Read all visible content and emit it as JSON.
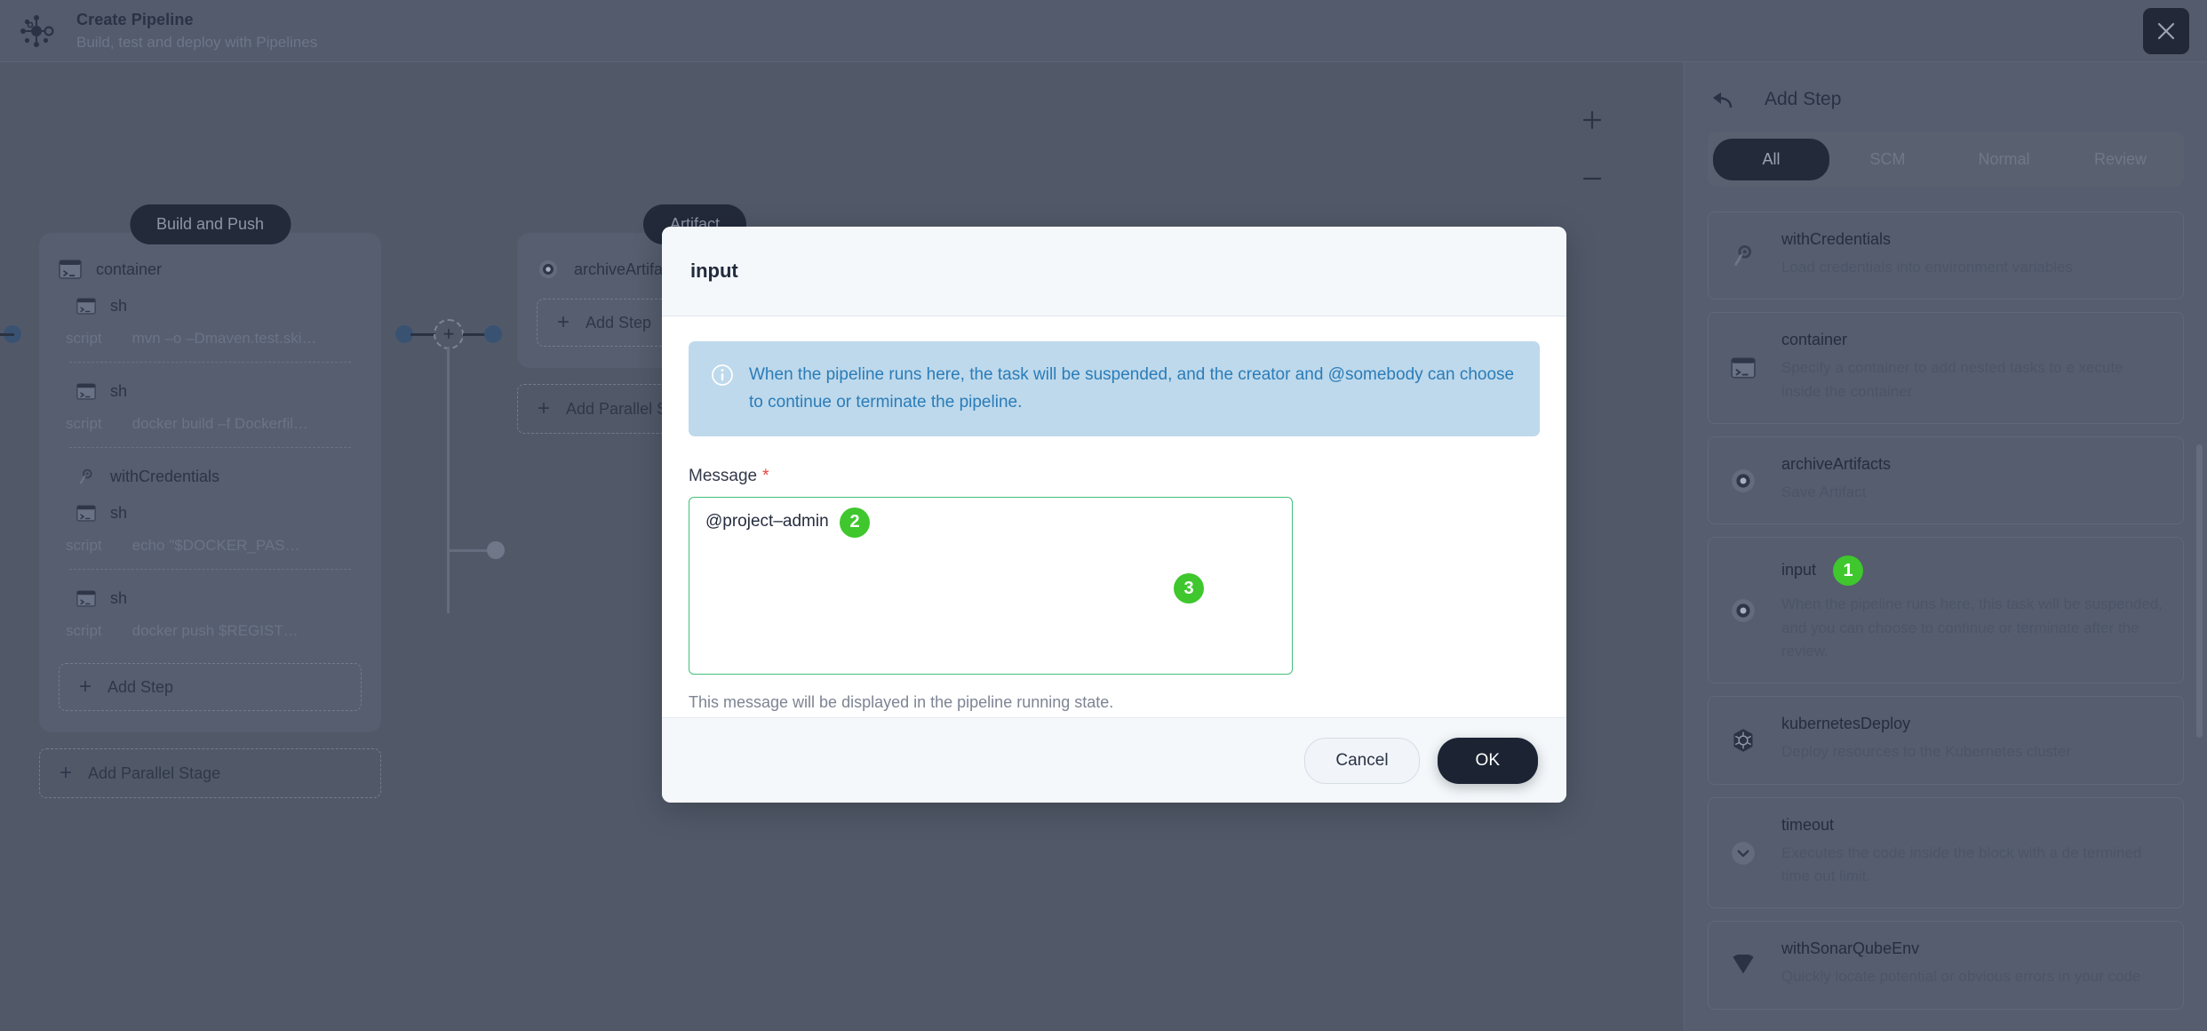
{
  "header": {
    "title": "Create Pipeline",
    "subtitle": "Build, test and deploy with Pipelines",
    "brand_icon": "pipeline-node-icon",
    "close_icon": "close-icon"
  },
  "canvas": {
    "zoom_in_label": "+",
    "zoom_out_label": "−",
    "stages": [
      {
        "label": "Build and Push",
        "steps": [
          {
            "icon": "terminal-icon",
            "name": "container",
            "indent": false
          },
          {
            "icon": "terminal-icon",
            "name": "sh",
            "indent": true,
            "script_key": "script",
            "script_value": "mvn –o –Dmaven.test.ski…"
          },
          {
            "icon": "terminal-icon",
            "name": "sh",
            "indent": true,
            "script_key": "script",
            "script_value": "docker build –f Dockerfil…"
          },
          {
            "icon": "key-icon",
            "name": "withCredentials",
            "indent": true
          },
          {
            "icon": "terminal-icon",
            "name": "sh",
            "indent": true,
            "script_key": "script",
            "script_value": "echo \"$DOCKER_PAS…"
          },
          {
            "icon": "terminal-icon",
            "name": "sh",
            "indent": true,
            "script_key": "script",
            "script_value": "docker push $REGIST…"
          }
        ],
        "add_step_label": "Add Step",
        "add_parallel_label": "Add Parallel Stage"
      },
      {
        "label": "Artifact",
        "steps": [
          {
            "icon": "record-icon",
            "name": "archiveArtifa",
            "indent": false
          }
        ],
        "add_step_label": "Add Step",
        "add_parallel_label": "Add Parallel S"
      }
    ],
    "plus_node_label": "+"
  },
  "right_panel": {
    "back_icon": "back-arrow-icon",
    "title": "Add Step",
    "tabs": [
      {
        "label": "All",
        "active": true
      },
      {
        "label": "SCM",
        "active": false
      },
      {
        "label": "Normal",
        "active": false
      },
      {
        "label": "Review",
        "active": false
      }
    ],
    "items": [
      {
        "icon": "key-icon",
        "name": "withCredentials",
        "desc": "Load credentials into environment variables",
        "badge": null
      },
      {
        "icon": "terminal-icon",
        "name": "container",
        "desc": "Specify a container to add nested tasks to e xecute inside the container",
        "badge": null
      },
      {
        "icon": "record-icon",
        "name": "archiveArtifacts",
        "desc": "Save Artifact",
        "badge": null
      },
      {
        "icon": "record-icon",
        "name": "input",
        "desc": "When the pipeline runs here, this task will be suspended, and you can choose to continue or terminate after the review.",
        "badge": "1"
      },
      {
        "icon": "kubernetes-icon",
        "name": "kubernetesDeploy",
        "desc": "Deploy resources to the Kubernetes cluster",
        "badge": null
      },
      {
        "icon": "chevron-down-circle-icon",
        "name": "timeout",
        "desc": "Executes the code inside the block with a de termined time out limit.",
        "badge": null
      },
      {
        "icon": "sonarqube-icon",
        "name": "withSonarQubeEnv",
        "desc": "Quickly locate potential or obvious errors in your code",
        "badge": null
      }
    ]
  },
  "modal": {
    "title": "input",
    "info_icon": "info-icon",
    "info_text": "When the pipeline runs here, the task will be suspended, and the creator and @somebody can choose to continue or terminate the pipeline.",
    "field_label": "Message",
    "required_mark": "*",
    "message_value": "@project–admin",
    "message_placeholder": "",
    "help_text": "This message will be displayed in the pipeline running state.",
    "cancel_label": "Cancel",
    "ok_label": "OK",
    "badge_message": "2",
    "badge_ok": "3"
  },
  "colors": {
    "accent_green": "#3fc72d",
    "info_blue": "#2a7cb8",
    "info_bg": "#bed9ec",
    "dark": "#1c2333",
    "field_border_green": "#41c17a",
    "required_red": "#e8453c"
  }
}
